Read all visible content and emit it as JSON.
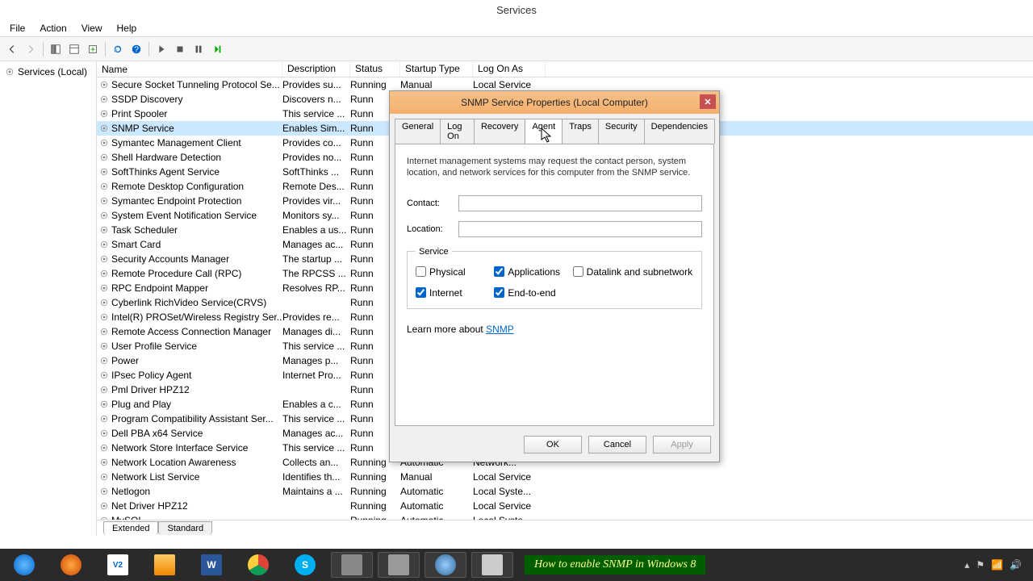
{
  "window": {
    "title": "Services"
  },
  "menu": {
    "file": "File",
    "action": "Action",
    "view": "View",
    "help": "Help"
  },
  "sidebar": {
    "root": "Services (Local)"
  },
  "columns": {
    "name": "Name",
    "description": "Description",
    "status": "Status",
    "startup": "Startup Type",
    "logon": "Log On As"
  },
  "services": [
    {
      "name": "Secure Socket Tunneling Protocol Se...",
      "desc": "Provides su...",
      "status": "Running",
      "startup": "Manual",
      "logon": "Local Service"
    },
    {
      "name": "SSDP Discovery",
      "desc": "Discovers n...",
      "status": "Runn",
      "startup": "",
      "logon": ""
    },
    {
      "name": "Print Spooler",
      "desc": "This service ...",
      "status": "Runn",
      "startup": "",
      "logon": ""
    },
    {
      "name": "SNMP Service",
      "desc": "Enables Sim...",
      "status": "Runn",
      "startup": "",
      "logon": "",
      "selected": true
    },
    {
      "name": "Symantec Management Client",
      "desc": "Provides co...",
      "status": "Runn",
      "startup": "",
      "logon": ""
    },
    {
      "name": "Shell Hardware Detection",
      "desc": "Provides no...",
      "status": "Runn",
      "startup": "",
      "logon": ""
    },
    {
      "name": "SoftThinks Agent Service",
      "desc": "SoftThinks ...",
      "status": "Runn",
      "startup": "",
      "logon": ""
    },
    {
      "name": "Remote Desktop Configuration",
      "desc": "Remote Des...",
      "status": "Runn",
      "startup": "",
      "logon": ""
    },
    {
      "name": "Symantec Endpoint Protection",
      "desc": "Provides vir...",
      "status": "Runn",
      "startup": "",
      "logon": ""
    },
    {
      "name": "System Event Notification Service",
      "desc": "Monitors sy...",
      "status": "Runn",
      "startup": "",
      "logon": ""
    },
    {
      "name": "Task Scheduler",
      "desc": "Enables a us...",
      "status": "Runn",
      "startup": "",
      "logon": ""
    },
    {
      "name": "Smart Card",
      "desc": "Manages ac...",
      "status": "Runn",
      "startup": "",
      "logon": ""
    },
    {
      "name": "Security Accounts Manager",
      "desc": "The startup ...",
      "status": "Runn",
      "startup": "",
      "logon": ""
    },
    {
      "name": "Remote Procedure Call (RPC)",
      "desc": "The RPCSS ...",
      "status": "Runn",
      "startup": "",
      "logon": ""
    },
    {
      "name": "RPC Endpoint Mapper",
      "desc": "Resolves RP...",
      "status": "Runn",
      "startup": "",
      "logon": ""
    },
    {
      "name": "Cyberlink RichVideo Service(CRVS)",
      "desc": "",
      "status": "Runn",
      "startup": "",
      "logon": ""
    },
    {
      "name": "Intel(R) PROSet/Wireless Registry Ser...",
      "desc": "Provides re...",
      "status": "Runn",
      "startup": "",
      "logon": ""
    },
    {
      "name": "Remote Access Connection Manager",
      "desc": "Manages di...",
      "status": "Runn",
      "startup": "",
      "logon": ""
    },
    {
      "name": "User Profile Service",
      "desc": "This service ...",
      "status": "Runn",
      "startup": "",
      "logon": ""
    },
    {
      "name": "Power",
      "desc": "Manages p...",
      "status": "Runn",
      "startup": "",
      "logon": ""
    },
    {
      "name": "IPsec Policy Agent",
      "desc": "Internet Pro...",
      "status": "Runn",
      "startup": "",
      "logon": ""
    },
    {
      "name": "Pml Driver HPZ12",
      "desc": "",
      "status": "Runn",
      "startup": "",
      "logon": ""
    },
    {
      "name": "Plug and Play",
      "desc": "Enables a c...",
      "status": "Runn",
      "startup": "",
      "logon": ""
    },
    {
      "name": "Program Compatibility Assistant Ser...",
      "desc": "This service ...",
      "status": "Runn",
      "startup": "",
      "logon": ""
    },
    {
      "name": "Dell PBA x64 Service",
      "desc": "Manages ac...",
      "status": "Runn",
      "startup": "",
      "logon": ""
    },
    {
      "name": "Network Store Interface Service",
      "desc": "This service ...",
      "status": "Runn",
      "startup": "",
      "logon": ""
    },
    {
      "name": "Network Location Awareness",
      "desc": "Collects an...",
      "status": "Running",
      "startup": "Automatic",
      "logon": "Network..."
    },
    {
      "name": "Network List Service",
      "desc": "Identifies th...",
      "status": "Running",
      "startup": "Manual",
      "logon": "Local Service"
    },
    {
      "name": "Netlogon",
      "desc": "Maintains a ...",
      "status": "Running",
      "startup": "Automatic",
      "logon": "Local Syste..."
    },
    {
      "name": "Net Driver HPZ12",
      "desc": "",
      "status": "Running",
      "startup": "Automatic",
      "logon": "Local Service"
    },
    {
      "name": "MySQL",
      "desc": "",
      "status": "Running",
      "startup": "Automatic",
      "logon": "Local Syste..."
    }
  ],
  "bottom_tabs": {
    "extended": "Extended",
    "standard": "Standard"
  },
  "dialog": {
    "title": "SNMP Service Properties (Local Computer)",
    "tabs": {
      "general": "General",
      "logon": "Log On",
      "recovery": "Recovery",
      "agent": "Agent",
      "traps": "Traps",
      "security": "Security",
      "dependencies": "Dependencies"
    },
    "desc": "Internet management systems may request the contact person, system location, and network services for this computer from the SNMP service.",
    "contact_label": "Contact:",
    "contact_value": "",
    "location_label": "Location:",
    "location_value": "",
    "service_legend": "Service",
    "checks": {
      "physical": "Physical",
      "applications": "Applications",
      "datalink": "Datalink and subnetwork",
      "internet": "Internet",
      "endtoend": "End-to-end"
    },
    "learn_prefix": "Learn more about ",
    "learn_link": "SNMP",
    "buttons": {
      "ok": "OK",
      "cancel": "Cancel",
      "apply": "Apply"
    }
  },
  "banner": "How to enable SNMP in Windows 8"
}
